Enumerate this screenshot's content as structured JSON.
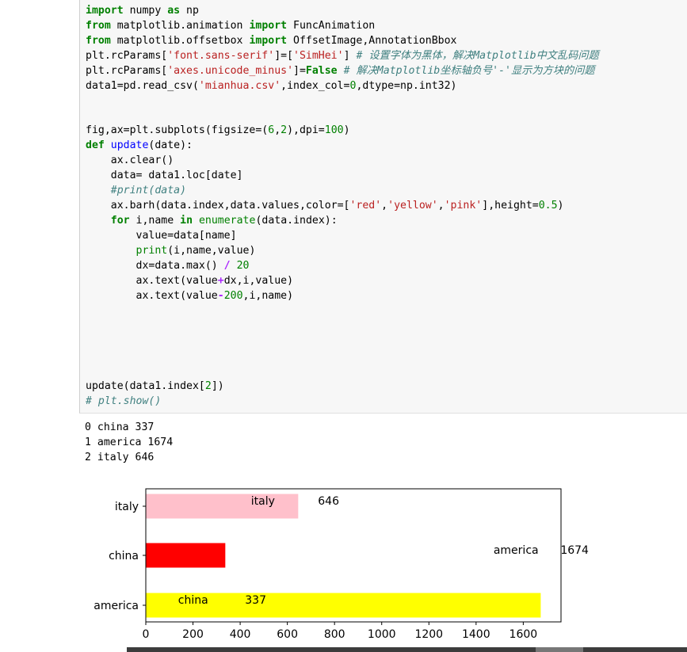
{
  "code": {
    "line1": {
      "kw1": "import",
      "t1": " numpy ",
      "kw2": "as",
      "t2": " np"
    },
    "line2": {
      "kw1": "from",
      "t1": " matplotlib.animation ",
      "kw2": "import",
      "t2": " FuncAnimation"
    },
    "line3": {
      "kw1": "from",
      "t1": " matplotlib.offsetbox ",
      "kw2": "import",
      "t2": " OffsetImage,AnnotationBbox"
    },
    "line4": {
      "t1": "plt.rcParams[",
      "s1": "'font.sans-serif'",
      "t2": "]=[",
      "s2": "'SimHei'",
      "t3": "] ",
      "c1": "# 设置字体为黑体，解决Matplotlib中文乱码问题"
    },
    "line5": {
      "t1": "plt.rcParams[",
      "s1": "'axes.unicode_minus'",
      "t2": "]=",
      "k1": "False",
      "t3": " ",
      "c1": "# 解决Matplotlib坐标轴负号'-'显示为方块的问题"
    },
    "line6": {
      "t1": "data1=pd.read_csv(",
      "s1": "'mianhua.csv'",
      "t2": ",index_col=",
      "n1": "0",
      "t3": ",dtype=np.int32)"
    },
    "line7": {
      "t1": "fig,ax=plt.subplots(figsize=(",
      "n1": "6",
      "t2": ",",
      "n2": "2",
      "t3": "),dpi=",
      "n3": "100",
      "t4": ")"
    },
    "line8": {
      "kw1": "def",
      "t1": " ",
      "f1": "update",
      "t2": "(date):"
    },
    "line9": {
      "t1": "    ax.clear()"
    },
    "line10": {
      "t1": "    data= data1.loc[date]"
    },
    "line11": {
      "c1": "    #print(data)"
    },
    "line12": {
      "t1": "    ax.barh(data.index,data.values,color=[",
      "s1": "'red'",
      "t2": ",",
      "s2": "'yellow'",
      "t3": ",",
      "s3": "'pink'",
      "t4": "],height=",
      "n1": "0.5",
      "t5": ")"
    },
    "line13": {
      "t0": "    ",
      "kw1": "for",
      "t1": " i,name ",
      "kw2": "in",
      "t2": " ",
      "f1": "enumerate",
      "t3": "(data.index):"
    },
    "line14": {
      "t1": "        value=data[name]"
    },
    "line15": {
      "t0": "        ",
      "f1": "print",
      "t1": "(i,name,value)"
    },
    "line16": {
      "t1": "        dx=data.max() ",
      "o1": "/",
      "t2": " ",
      "n1": "20"
    },
    "line17": {
      "t1": "        ax.text(value",
      "o1": "+",
      "t2": "dx,i,value)"
    },
    "line18": {
      "t1": "        ax.text(value",
      "o1": "-",
      "n1": "200",
      "t2": ",i,name)"
    },
    "line19": {
      "t1": "update(data1.index[",
      "n1": "2",
      "t2": "])"
    },
    "line20": {
      "c1": "# plt.show()"
    }
  },
  "output": {
    "lines": [
      "0 china 337",
      "1 america 1674",
      "2 italy 646"
    ]
  },
  "chart_data": {
    "type": "bar",
    "orientation": "horizontal",
    "categories": [
      "america",
      "china",
      "italy"
    ],
    "values": [
      1674,
      337,
      646
    ],
    "colors": [
      "#ffff00",
      "#ff0000",
      "#ffc0cb"
    ],
    "xticks": [
      "0",
      "200",
      "400",
      "600",
      "800",
      "1000",
      "1200",
      "1400",
      "1600"
    ],
    "xlim": [
      0,
      1760
    ],
    "value_labels": [
      "337",
      "1674",
      "646"
    ],
    "name_labels": [
      "china",
      "america",
      "italy"
    ],
    "text_annotations": [
      {
        "text": "china",
        "x": 137,
        "y": 0
      },
      {
        "text": "337",
        "x": 420.7,
        "y": 0
      },
      {
        "text": "america",
        "x": 1474,
        "y": 1
      },
      {
        "text": "1674",
        "x": 1757.7,
        "y": 1
      },
      {
        "text": "italy",
        "x": 446,
        "y": 2
      },
      {
        "text": "646",
        "x": 729.7,
        "y": 2
      }
    ]
  }
}
